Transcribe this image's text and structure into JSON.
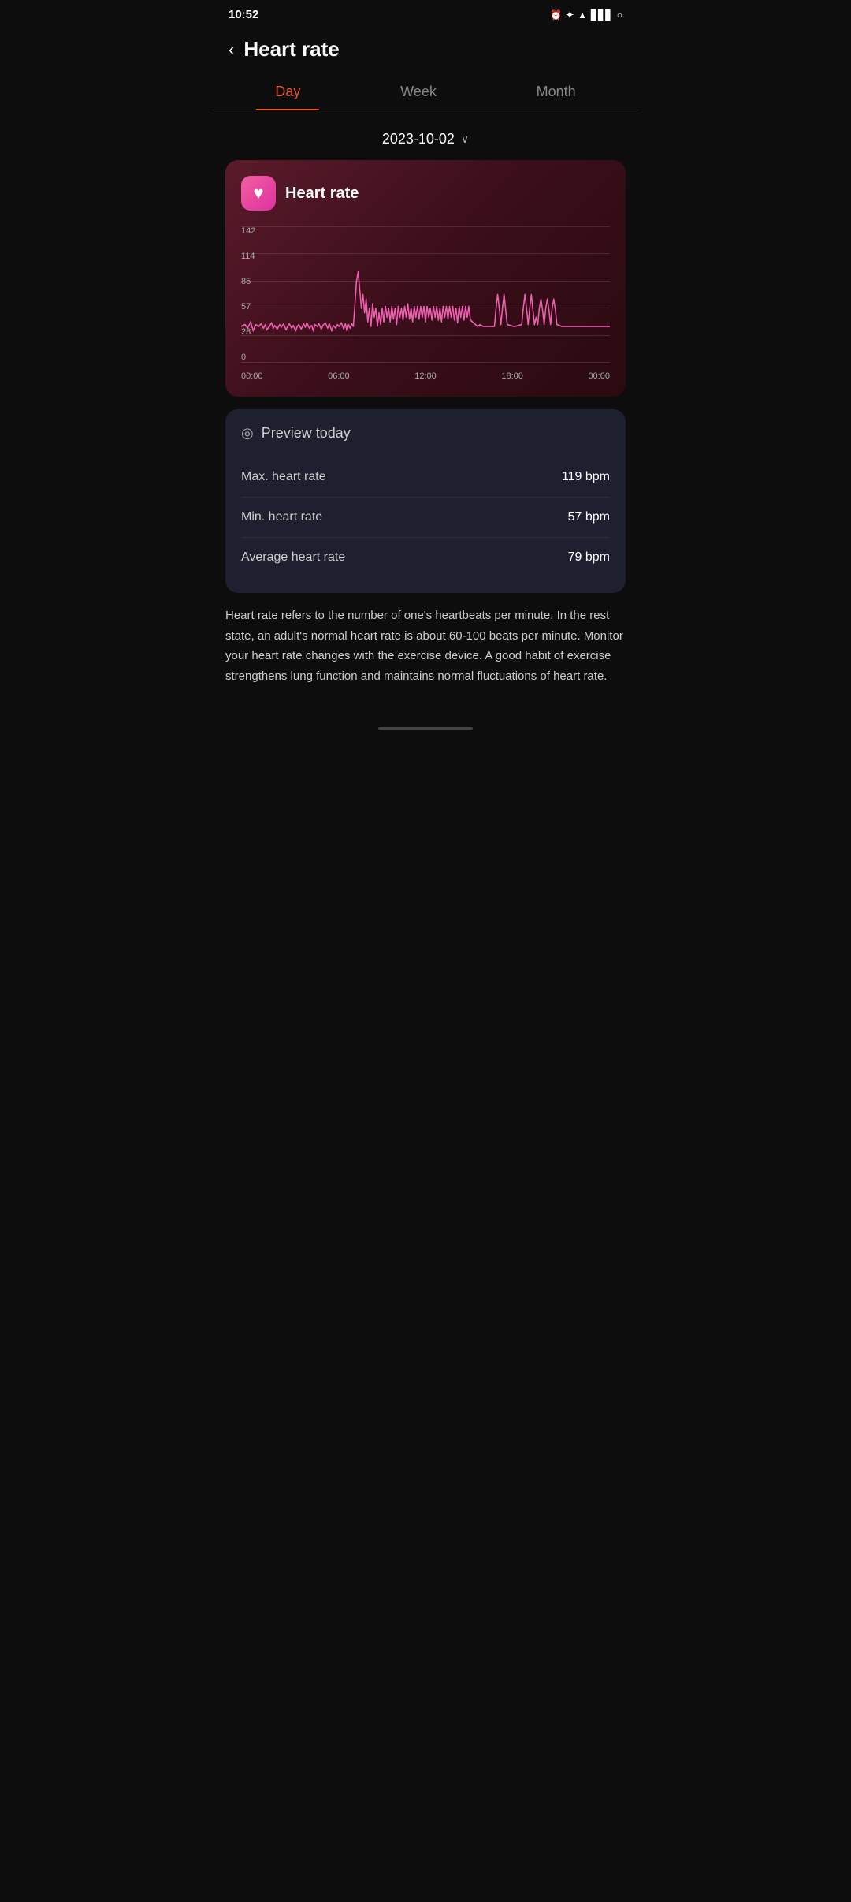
{
  "statusBar": {
    "time": "10:52",
    "icons": [
      "alarm",
      "bluetooth",
      "wifi",
      "signal",
      "circle"
    ]
  },
  "header": {
    "backLabel": "‹",
    "title": "Heart rate"
  },
  "tabs": [
    {
      "id": "day",
      "label": "Day",
      "active": true
    },
    {
      "id": "week",
      "label": "Week",
      "active": false
    },
    {
      "id": "month",
      "label": "Month",
      "active": false
    }
  ],
  "dateSelector": {
    "date": "2023-10-02",
    "chevron": "∨"
  },
  "chart": {
    "title": "Heart rate",
    "yLabels": [
      "142",
      "114",
      "85",
      "57",
      "28",
      "0"
    ],
    "xLabels": [
      "00:00",
      "06:00",
      "12:00",
      "18:00",
      "00:00"
    ]
  },
  "previewSection": {
    "title": "Preview today",
    "stats": [
      {
        "label": "Max. heart rate",
        "value": "119 bpm"
      },
      {
        "label": "Min. heart rate",
        "value": "57 bpm"
      },
      {
        "label": "Average heart rate",
        "value": "79 bpm"
      }
    ]
  },
  "description": "Heart rate refers to the number of one's heartbeats per minute. In the rest state, an adult's normal heart rate is about 60-100 beats per minute. Monitor your heart rate changes with the exercise device. A good habit of exercise strengthens lung function and maintains normal fluctuations of heart rate."
}
